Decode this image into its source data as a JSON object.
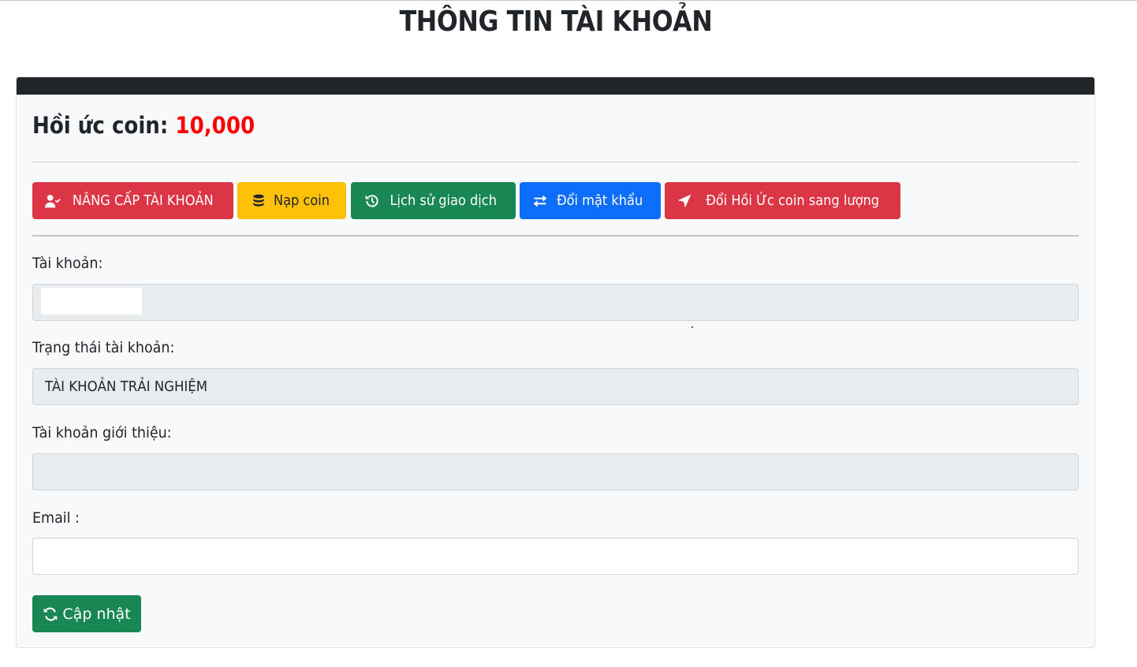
{
  "page": {
    "title": "THÔNG TIN TÀI KHOẢN"
  },
  "balance": {
    "label": "Hồi ức coin:",
    "amount": "10,000"
  },
  "actions": {
    "upgrade": "NÂNG CẤP TÀI KHOẢN",
    "topup": "Nạp coin",
    "history": "Lịch sử giao dịch",
    "change_password": "Đổi mật khẩu",
    "convert": "Đổi Hồi Ức coin sang lượng"
  },
  "form": {
    "account_label": "Tài khoản:",
    "account_value": "",
    "status_label": "Trạng thái tài khoản:",
    "status_value": "TÀI KHOẢN TRẢI NGHIỆM",
    "referrer_label": "Tài khoản giới thiệu:",
    "referrer_value": "",
    "email_label": "Email :",
    "email_value": "",
    "submit_label": "Cập nhật"
  },
  "colors": {
    "danger": "#dc3545",
    "warning": "#ffc107",
    "success": "#198754",
    "primary": "#0d6efd",
    "coin_amount": "#ff0000",
    "card_header": "#212529"
  },
  "icons": {
    "upgrade": "user-check-icon",
    "topup": "coins-icon",
    "history": "history-icon",
    "change_password": "exchange-arrows-icon",
    "convert": "paper-plane-icon",
    "submit": "refresh-icon"
  }
}
